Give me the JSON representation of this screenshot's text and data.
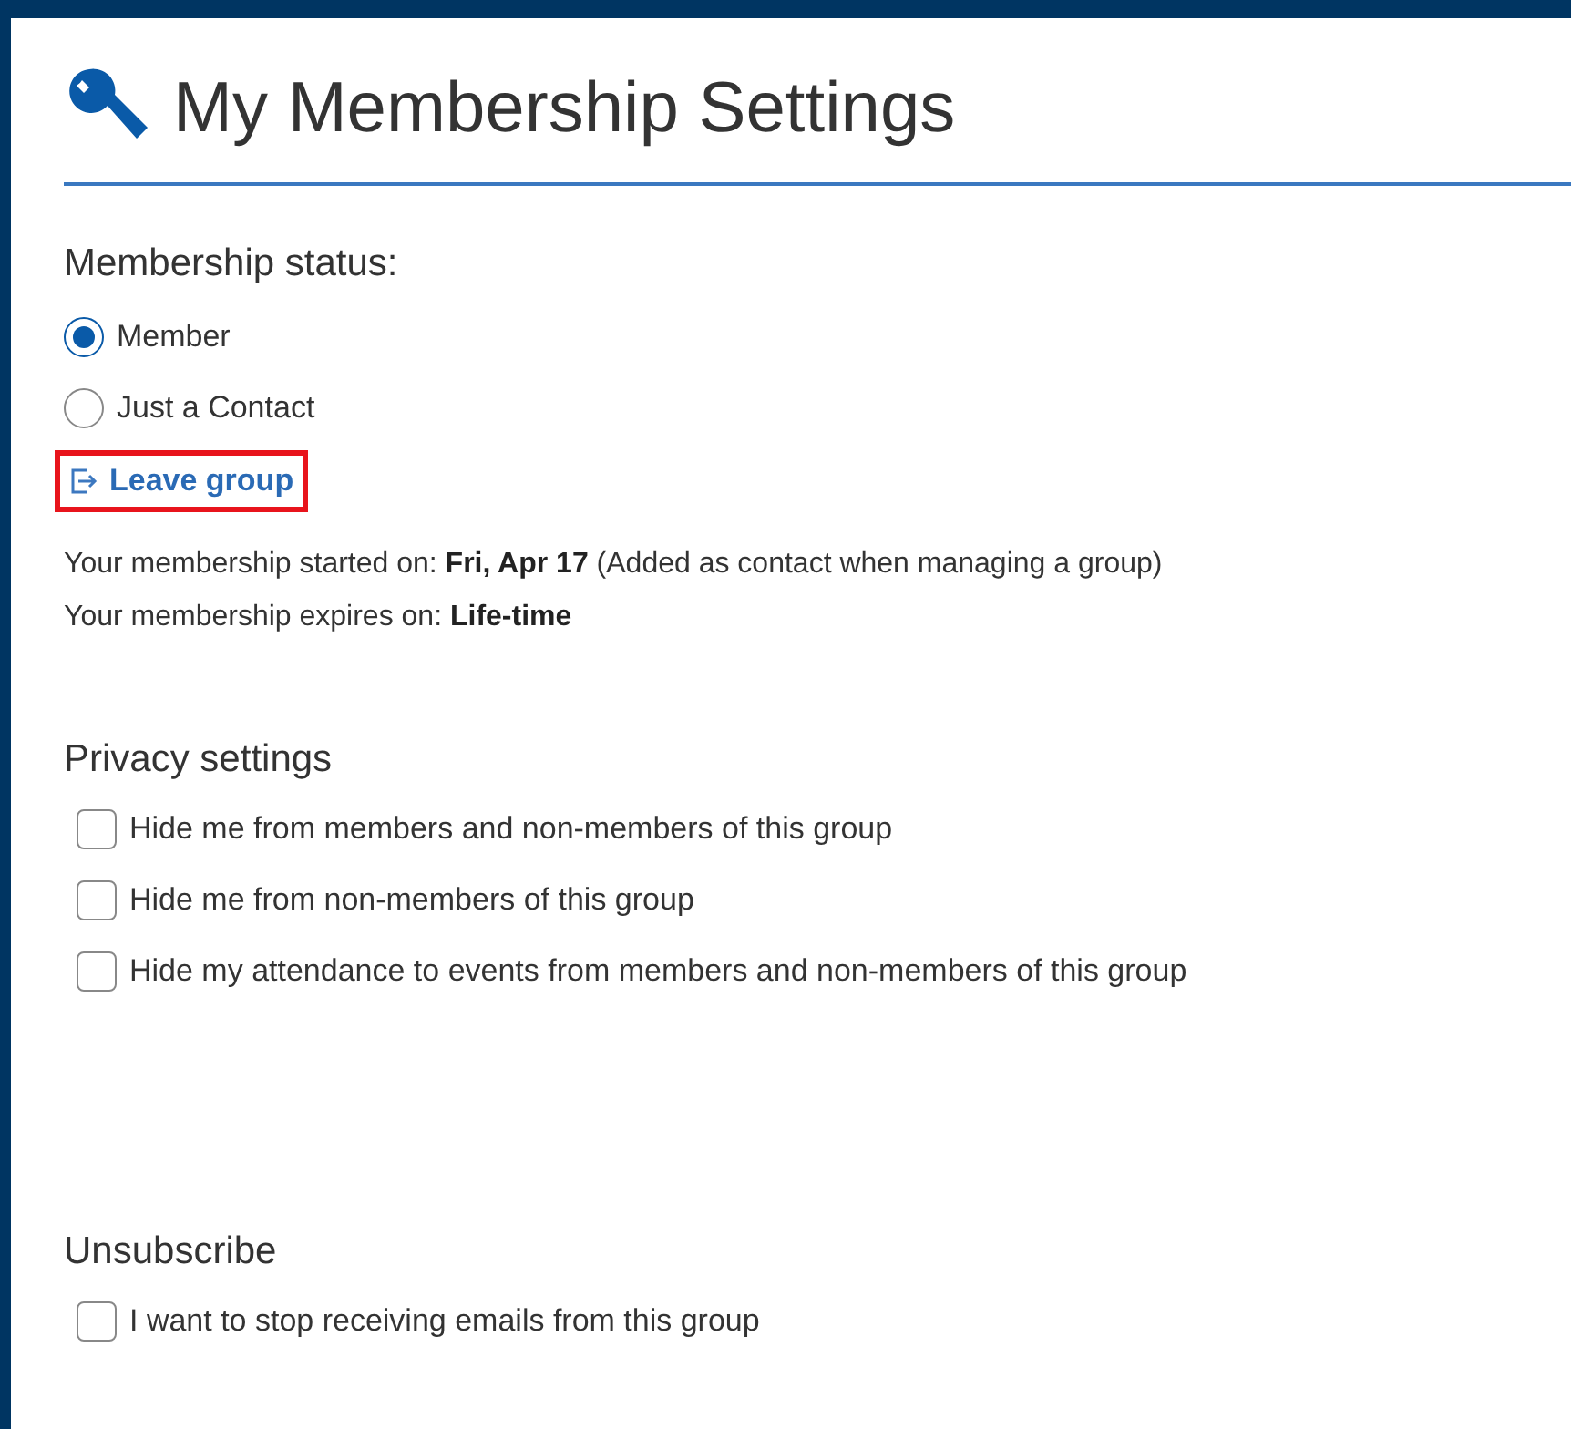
{
  "title": "My Membership Settings",
  "membership": {
    "heading": "Membership status:",
    "options": [
      {
        "label": "Member",
        "selected": true
      },
      {
        "label": "Just a Contact",
        "selected": false
      }
    ],
    "leave_link": {
      "label": "Leave group",
      "highlighted": true
    },
    "info": [
      "Your membership started on: **Fri, Apr 17**  (Added as contact when managing a group)",
      "Your membership expires on: **Life-time**"
    ]
  },
  "privacy": {
    "heading": "Privacy settings",
    "options": [
      {
        "label": "Hide me from members and non-members of this group",
        "checked": false
      },
      {
        "label": "Hide me from non-members of this group",
        "checked": false
      },
      {
        "label": "Hide my attendance to events from members and non-members of this group",
        "checked": false
      }
    ]
  },
  "unsubscribe": {
    "heading": "Unsubscribe",
    "options": [
      {
        "label": "I want to stop receiving emails from this group",
        "checked": false
      }
    ]
  }
}
